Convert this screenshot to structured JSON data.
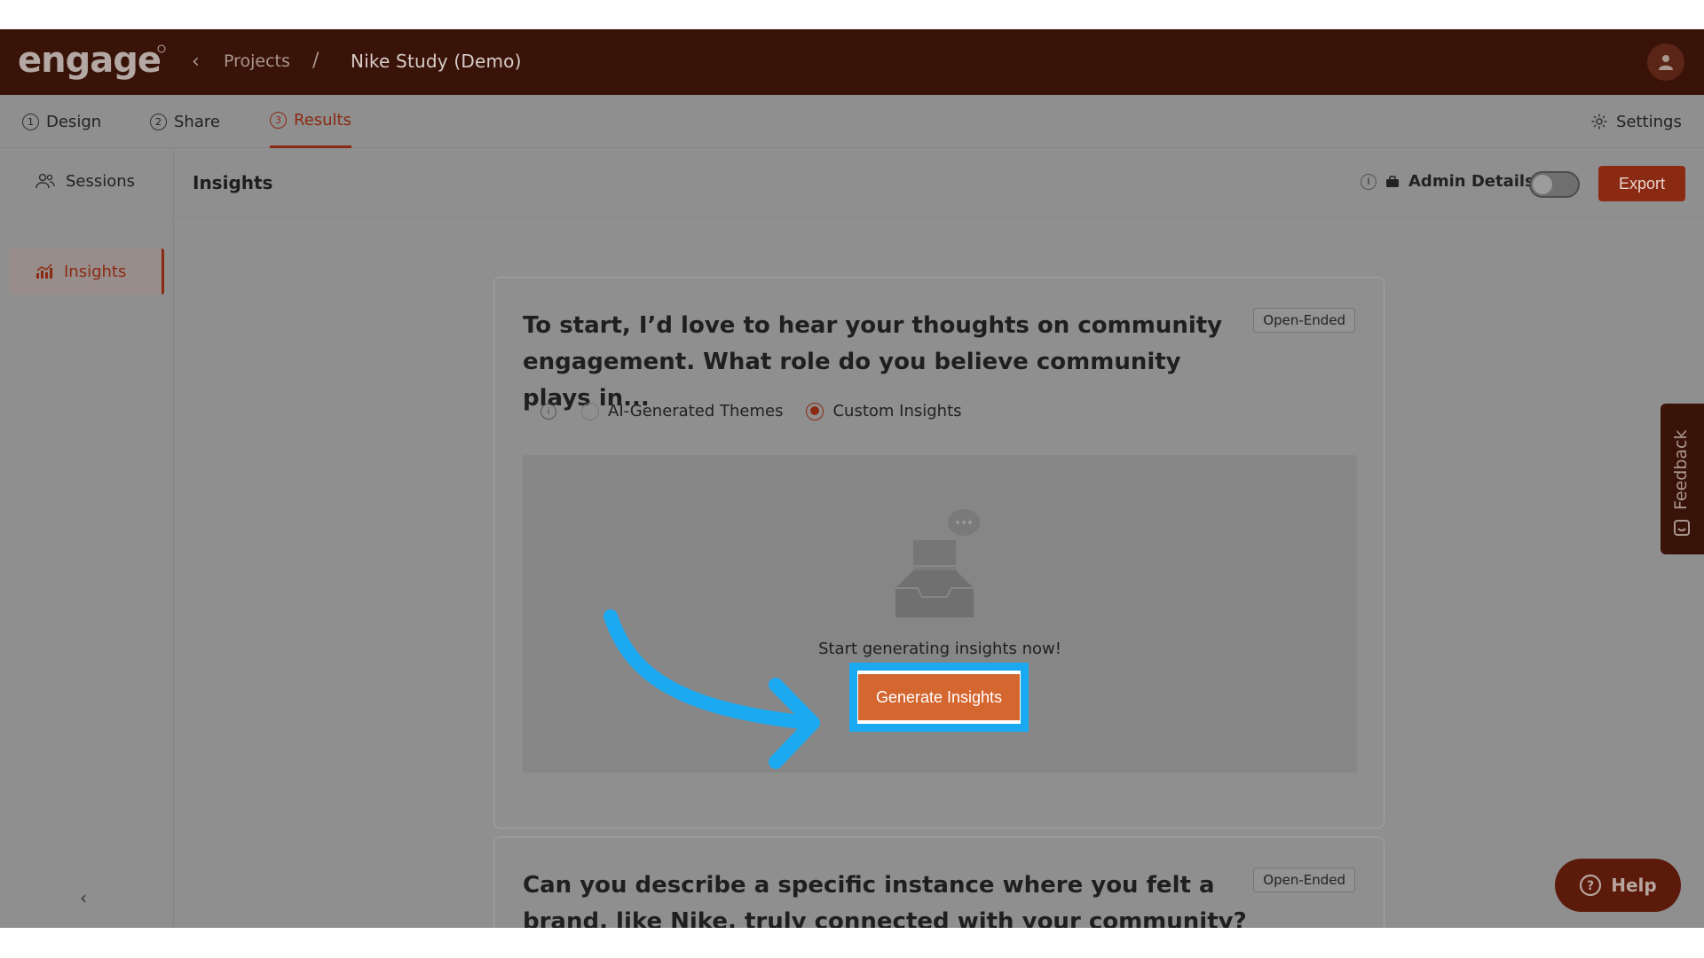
{
  "app": {
    "logo_text": "engage",
    "breadcrumb": {
      "back_icon": "chevron-left-icon",
      "projects": "Projects",
      "separator": "/",
      "current": "Nike Study (Demo)"
    }
  },
  "tabs": [
    {
      "num": "1",
      "label": "Design"
    },
    {
      "num": "2",
      "label": "Share"
    },
    {
      "num": "3",
      "label": "Results",
      "active": true
    }
  ],
  "settings_label": "Settings",
  "sidebar": {
    "items": [
      {
        "label": "Sessions",
        "icon": "users-icon"
      },
      {
        "label": "Insights",
        "icon": "chart-icon",
        "active": true
      }
    ],
    "collapse_glyph": "‹"
  },
  "header": {
    "title": "Insights",
    "admin_label": "Admin Details",
    "admin_toggle_on": false,
    "export_label": "Export"
  },
  "questions": [
    {
      "text": "To start, I’d love to hear your thoughts on community engagement. What role do you believe community plays in...",
      "badge": "Open-Ended",
      "options": [
        "AI-Generated Themes",
        "Custom Insights"
      ],
      "selected": "Custom Insights",
      "empty_message": "Start generating insights now!",
      "cta": "Generate Insights"
    },
    {
      "text": "Can you describe a specific instance where you felt a brand, like Nike, truly connected with your community? What actio...",
      "badge": "Open-Ended"
    }
  ],
  "feedback_label": "Feedback",
  "help_label": "Help",
  "colors": {
    "brand_dark": "#3a1308",
    "accent": "#8b2a12",
    "cta": "#d4662f",
    "highlight": "#1aa9f1"
  }
}
